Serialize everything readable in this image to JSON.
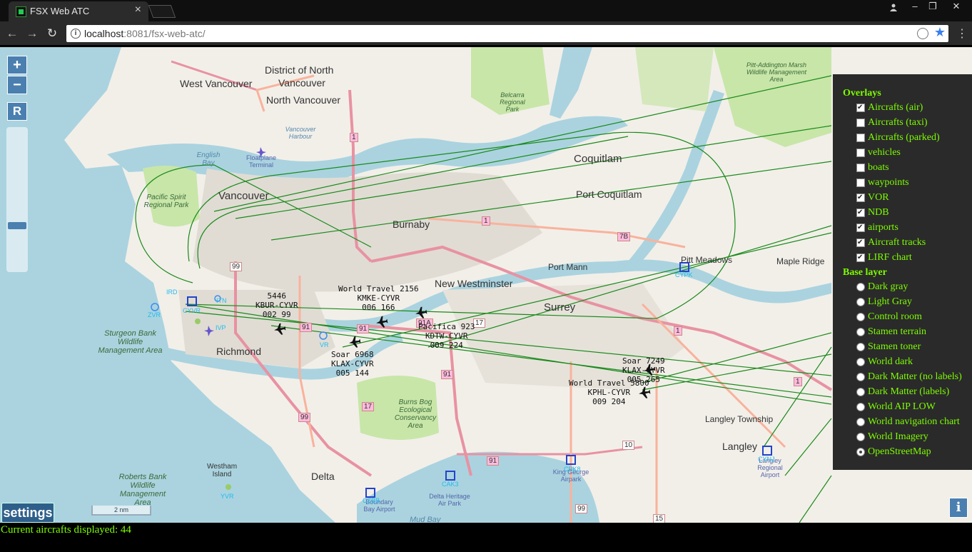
{
  "browser": {
    "tab_title": "FSX Web ATC",
    "tab_close": "×",
    "url_host": "localhost",
    "url_rest": ":8081/fsx-web-atc/",
    "win_min": "–",
    "win_max": "❐",
    "win_close": "✕",
    "back": "←",
    "forward": "→",
    "reload": "↻",
    "star": "★",
    "menu": "⋮",
    "info_glyph": "i"
  },
  "map_controls": {
    "zoom_in": "+",
    "zoom_out": "−",
    "reset": "R",
    "settings": "settings",
    "scale": "2 nm",
    "info": "i"
  },
  "places": [
    {
      "name": "District of North",
      "cls": "city"
    },
    {
      "name": "Vancouver",
      "cls": "city"
    },
    {
      "name": "West Vancouver",
      "cls": "city"
    },
    {
      "name": "North Vancouver",
      "cls": "city"
    },
    {
      "name": "Vancouver",
      "cls": "bigcity"
    },
    {
      "name": "Coquitlam",
      "cls": "city"
    },
    {
      "name": "Port Coquitlam",
      "cls": "city"
    },
    {
      "name": "Burnaby",
      "cls": "city"
    },
    {
      "name": "New Westminster",
      "cls": "city"
    },
    {
      "name": "Surrey",
      "cls": "city"
    },
    {
      "name": "Richmond",
      "cls": "city"
    },
    {
      "name": "Delta",
      "cls": "city"
    },
    {
      "name": "Langley",
      "cls": "city"
    },
    {
      "name": "Langley Township",
      "cls": "small"
    },
    {
      "name": "Port Mann",
      "cls": "small"
    },
    {
      "name": "Pitt Meadows",
      "cls": "small"
    },
    {
      "name": "Maple Ridge",
      "cls": "small"
    }
  ],
  "parks": [
    "Pacific Spirit Regional Park",
    "Sturgeon Bank Wildlife Management Area",
    "Burns Bog Ecological Conservancy Area",
    "Roberts Bank Wildlife Management Area",
    "Westham Island",
    "Belcarra Regional Park",
    "Pitt-Addington Marsh Wildlife Management Area",
    "English Bay",
    "Vancouver Harbour",
    "Floatplane Terminal",
    "Mud Bay",
    "Delta Heritage Air Park",
    "Boundary Bay Airport",
    "King George Airpark",
    "Langley Regional Airport"
  ],
  "nav_labels": [
    "IRD",
    "CYVR",
    "ZVR",
    "IVP",
    "VR",
    "ITN",
    "CYPK",
    "CAK3",
    "CZBB",
    "CBK8",
    "CYNJ",
    "YVR"
  ],
  "road_shields": [
    "99",
    "91",
    "91",
    "1",
    "7B",
    "91",
    "17",
    "99",
    "91",
    "10",
    "15",
    "99",
    "1",
    "1",
    "1",
    "17",
    "7",
    "91A"
  ],
  "aircraft": [
    {
      "line1": "5446",
      "line2": "KBUR-CYVR",
      "line3": "002 99"
    },
    {
      "line1": "World Travel 2156",
      "line2": "KMKE-CYVR",
      "line3": "006 166"
    },
    {
      "line1": "Pacifica 923",
      "line2": "KDTW-CYVR",
      "line3": "009 224"
    },
    {
      "line1": "Soar 6968",
      "line2": "KLAX-CYVR",
      "line3": "005 144"
    },
    {
      "line1": "Soar 7249",
      "line2": "KLAX-CYVR",
      "line3": "005 265"
    },
    {
      "line1": "World Travel 5800",
      "line2": "KPHL-CYVR",
      "line3": "009 204"
    }
  ],
  "panel": {
    "overlays_title": "Overlays",
    "overlays": [
      {
        "label": "Aircrafts (air)",
        "checked": true
      },
      {
        "label": "Aircrafts (taxi)",
        "checked": false
      },
      {
        "label": "Aircrafts (parked)",
        "checked": false
      },
      {
        "label": "vehicles",
        "checked": false
      },
      {
        "label": "boats",
        "checked": false
      },
      {
        "label": "waypoints",
        "checked": false
      },
      {
        "label": "VOR",
        "checked": true
      },
      {
        "label": "NDB",
        "checked": true
      },
      {
        "label": "airports",
        "checked": true
      },
      {
        "label": "Aircraft tracks",
        "checked": true
      },
      {
        "label": "LIRF chart",
        "checked": true
      }
    ],
    "base_title": "Base layer",
    "base": [
      {
        "label": "Dark gray",
        "selected": false
      },
      {
        "label": "Light Gray",
        "selected": false
      },
      {
        "label": "Control room",
        "selected": false
      },
      {
        "label": "Stamen terrain",
        "selected": false
      },
      {
        "label": "Stamen toner",
        "selected": false
      },
      {
        "label": "World dark",
        "selected": false
      },
      {
        "label": "Dark Matter (no labels)",
        "selected": false
      },
      {
        "label": "Dark Matter (labels)",
        "selected": false
      },
      {
        "label": "World AIP LOW",
        "selected": false
      },
      {
        "label": "World navigation chart",
        "selected": false
      },
      {
        "label": "World Imagery",
        "selected": false
      },
      {
        "label": "OpenStreetMap",
        "selected": true
      }
    ]
  },
  "status": "Current aircrafts displayed: 44",
  "colors": {
    "panel_text": "#7dfc00",
    "water": "#aad3df",
    "track": "#1a8a1a",
    "control": "#4a7fb0"
  }
}
